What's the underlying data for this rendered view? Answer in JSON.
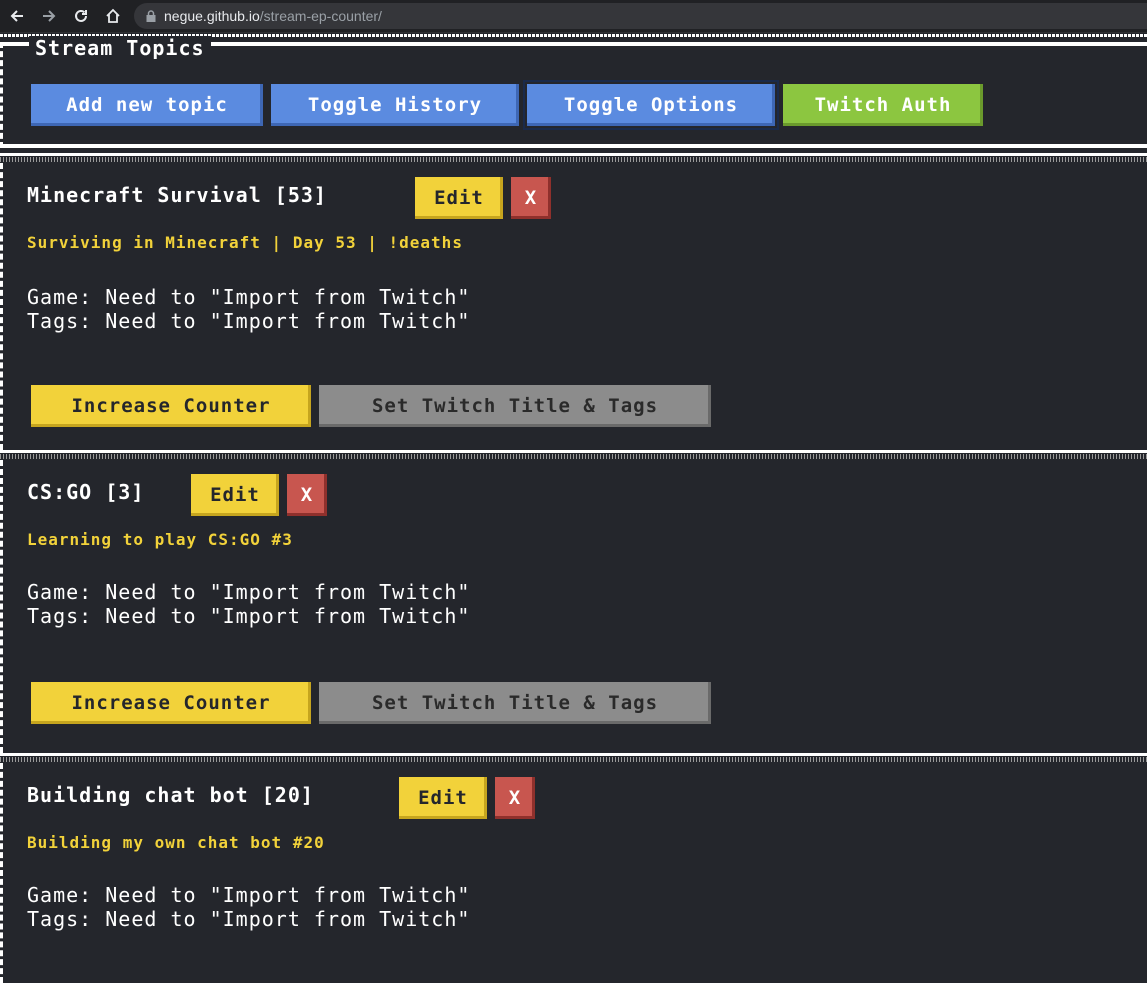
{
  "browser": {
    "url_host": "negue.github.io",
    "url_path": "/stream-ep-counter/"
  },
  "header": {
    "title": "Stream Topics",
    "buttons": {
      "add_topic": "Add new topic",
      "toggle_history": "Toggle History",
      "toggle_options": "Toggle Options",
      "twitch_auth": "Twitch Auth"
    }
  },
  "topics": [
    {
      "title": "Minecraft Survival [53]",
      "edit": "Edit",
      "delete": "X",
      "subtitle": "Surviving in Minecraft | Day 53 | !deaths",
      "game": "Game: Need to \"Import from Twitch\"",
      "tags": "Tags: Need to \"Import from Twitch\"",
      "increase": "Increase Counter",
      "set_twitch": "Set Twitch Title & Tags"
    },
    {
      "title": "CS:GO [3]",
      "edit": "Edit",
      "delete": "X",
      "subtitle": "Learning to play CS:GO #3",
      "game": "Game: Need to \"Import from Twitch\"",
      "tags": "Tags: Need to \"Import from Twitch\"",
      "increase": "Increase Counter",
      "set_twitch": "Set Twitch Title & Tags"
    },
    {
      "title": "Building chat bot [20]",
      "edit": "Edit",
      "delete": "X",
      "subtitle": "Building my own chat bot #20",
      "game": "Game: Need to \"Import from Twitch\"",
      "tags": "Tags: Need to \"Import from Twitch\""
    }
  ],
  "colors": {
    "background": "#24262c",
    "blue": "#5b8be0",
    "green": "#8cc640",
    "yellow": "#f2d23a",
    "red": "#c8564f",
    "gray": "#8c8c8c"
  }
}
